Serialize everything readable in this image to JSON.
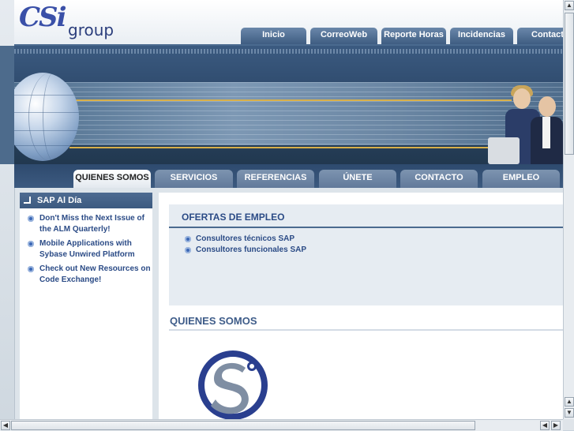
{
  "header": {
    "logo_mark": "CSi",
    "logo_text": "group",
    "top_tabs": [
      {
        "label": "Inicio"
      },
      {
        "label": "CorreoWeb"
      },
      {
        "label": "Reporte Horas"
      },
      {
        "label": "Incidencias"
      },
      {
        "label": "Contacta"
      }
    ]
  },
  "nav": {
    "tabs": [
      {
        "label": "QUIENES SOMOS",
        "active": true
      },
      {
        "label": "SERVICIOS"
      },
      {
        "label": "REFERENCIAS"
      },
      {
        "label": "ÚNETE"
      },
      {
        "label": "CONTACTO"
      },
      {
        "label": "EMPLEO"
      }
    ]
  },
  "sidebar": {
    "title": "SAP Al Día",
    "items": [
      {
        "label": "Don't Miss the Next Issue of the ALM Quarterly!"
      },
      {
        "label": "Mobile Applications with Sybase Unwired Platform"
      },
      {
        "label": "Check out New Resources on Code Exchange!"
      }
    ]
  },
  "content": {
    "ofertas_title": "OFERTAS DE EMPLEO",
    "ofertas_items": [
      {
        "label": "Consultores técnicos SAP"
      },
      {
        "label": "Consultores funcionales SAP"
      }
    ],
    "section_title": "QUIENES SOMOS"
  },
  "colors": {
    "brand": "#3a50a8",
    "nav_dark": "#2e4a6e",
    "link": "#2b4b86"
  }
}
